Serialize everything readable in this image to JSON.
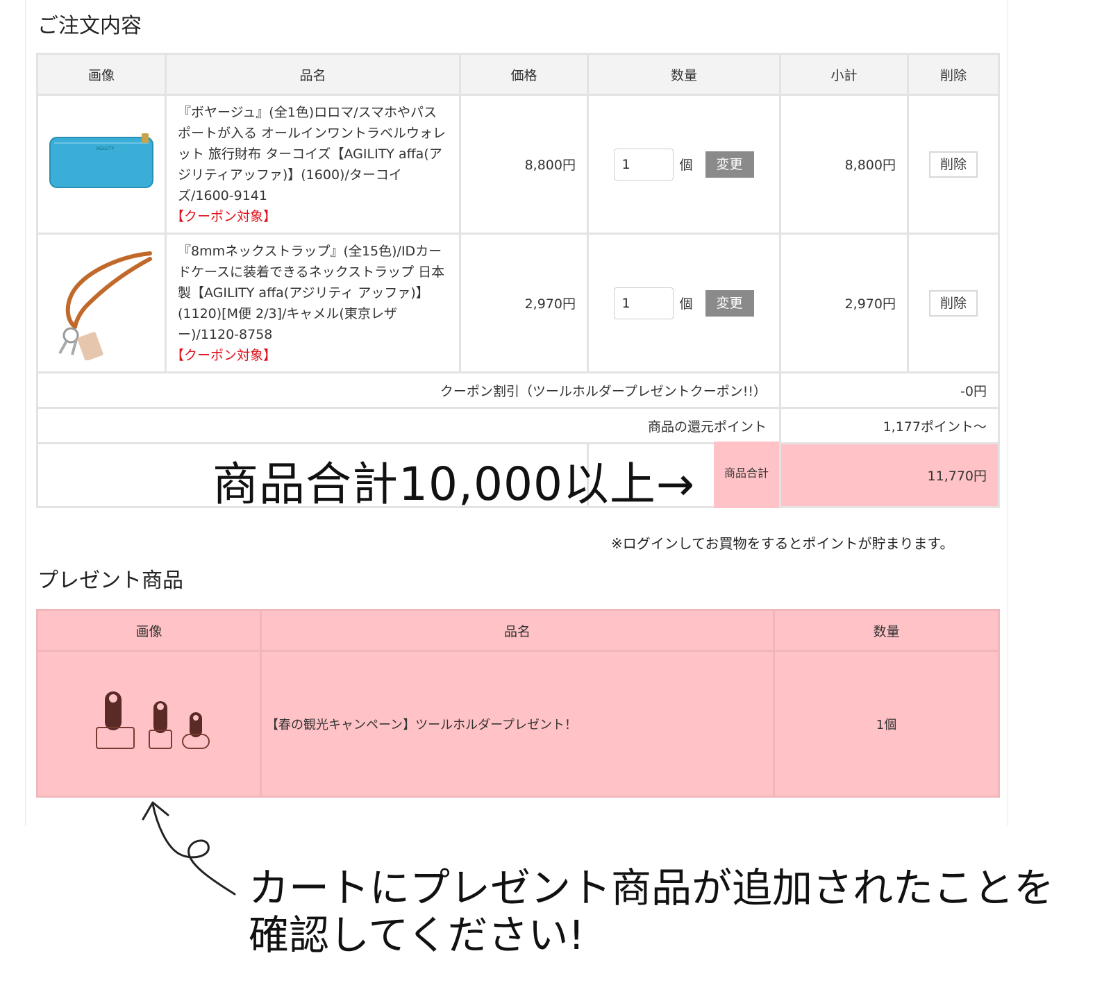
{
  "order": {
    "title": "ご注文内容",
    "headers": {
      "image": "画像",
      "name": "品名",
      "price": "価格",
      "qty": "数量",
      "subtotal": "小計",
      "delete": "削除"
    },
    "items": [
      {
        "name": "『ボヤージュ』(全1色)ロロマ/スマホやパスポートが入る オールインワントラベルウォレット 旅行財布 ターコイズ【AGILITY affa(アジリティアッファ)】(1600)/ターコイズ/1600-9141",
        "coupon": "【クーポン対象】",
        "price": "8,800円",
        "qty": "1",
        "unit": "個",
        "change": "変更",
        "subtotal": "8,800円",
        "delete": "削除",
        "image_color": "#3aaed6"
      },
      {
        "name": "『8mmネックストラップ』(全15色)/IDカードケースに装着できるネックストラップ 日本製【AGILITY affa(アジリティ アッファ)】(1120)[M便 2/3]/キャメル(東京レザー)/1120-8758",
        "coupon": "【クーポン対象】",
        "price": "2,970円",
        "qty": "1",
        "unit": "個",
        "change": "変更",
        "subtotal": "2,970円",
        "delete": "削除",
        "image_color": "#c0692a"
      }
    ],
    "coupon_discount": {
      "label": "クーポン割引（ツールホルダープレゼントクーポン!!）",
      "value": "-0円"
    },
    "points": {
      "label": "商品の還元ポイント",
      "value": "1,177ポイント〜"
    },
    "total": {
      "label": "商品合計",
      "value": "11,770円"
    },
    "annotation": "商品合計10,000以上→",
    "login_note": "※ログインしてお買物をするとポイントが貯まります。"
  },
  "present": {
    "title": "プレゼント商品",
    "headers": {
      "image": "画像",
      "name": "品名",
      "qty": "数量"
    },
    "item": {
      "name": "【春の観光キャンペーン】ツールホルダープレゼント！",
      "qty": "1個"
    }
  },
  "callout": {
    "line1": "カートにプレゼント商品が追加されたことを",
    "line2": "確認してください!"
  },
  "colors": {
    "highlight": "#ffc2c6",
    "coupon": "#e0111b",
    "button": "#8a8a8a"
  }
}
